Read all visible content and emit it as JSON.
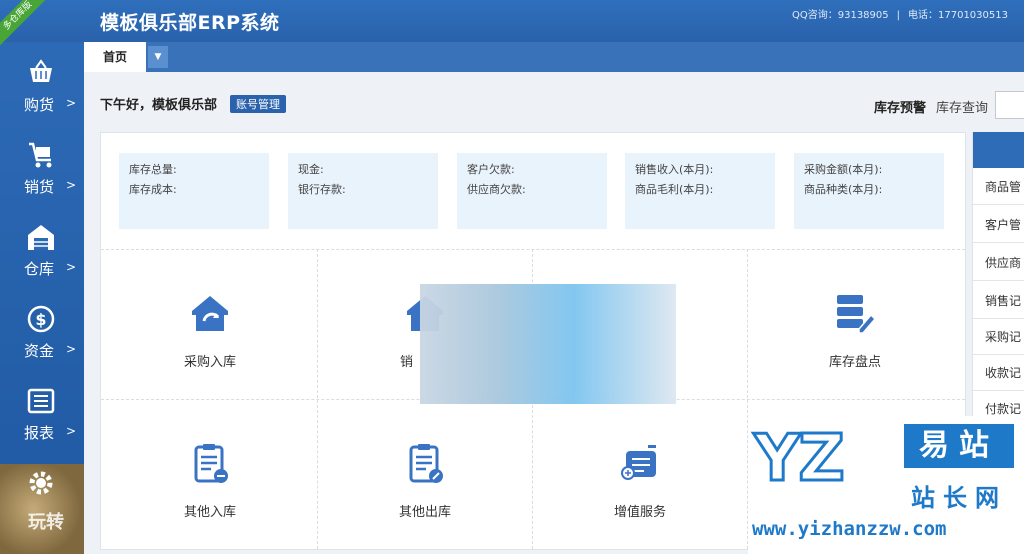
{
  "ribbon": "多仓库版",
  "header": {
    "title": "模板俱乐部ERP系统",
    "qq": "QQ咨询：93138905",
    "phone": "电话：17701030513"
  },
  "sidebar": {
    "items": [
      {
        "label": "购货",
        "icon": "basket-icon"
      },
      {
        "label": "销货",
        "icon": "cart-icon"
      },
      {
        "label": "仓库",
        "icon": "warehouse-icon"
      },
      {
        "label": "资金",
        "icon": "dollar-icon"
      },
      {
        "label": "报表",
        "icon": "report-icon"
      },
      {
        "label": "设置",
        "icon": "gear-icon"
      }
    ]
  },
  "tabs": {
    "home": "首页"
  },
  "greeting": "下午好，模板俱乐部",
  "account_button": "账号管理",
  "stock": {
    "warning": "库存预警",
    "query": "库存查询"
  },
  "stats": [
    {
      "line1": "库存总量:",
      "line2": "库存成本:"
    },
    {
      "line1": "现金:",
      "line2": "银行存款:"
    },
    {
      "line1": "客户欠款:",
      "line2": "供应商欠款:"
    },
    {
      "line1": "销售收入(本月):",
      "line2": "商品毛利(本月):"
    },
    {
      "line1": "采购金额(本月):",
      "line2": "商品种类(本月):"
    }
  ],
  "tiles": [
    {
      "label": "采购入库",
      "icon": "purchase-in-icon"
    },
    {
      "label": "销",
      "icon": "sales-out-icon"
    },
    {
      "label": "",
      "icon": "blurred"
    },
    {
      "label": "库存盘点",
      "icon": "inventory-check-icon"
    },
    {
      "label": "其他入库",
      "icon": "other-in-icon"
    },
    {
      "label": "其他出库",
      "icon": "other-out-icon"
    },
    {
      "label": "增值服务",
      "icon": "value-added-icon"
    }
  ],
  "right_list": [
    "商品管",
    "客户管",
    "供应商",
    "销售记",
    "采购记",
    "收款记",
    "付款记"
  ],
  "watermark": {
    "logo": "YZ",
    "cn1": "易站",
    "cn2": "站长网",
    "url": "www.yizhanzzw.com"
  },
  "corner_watermark": "玩转",
  "colors": {
    "primary": "#2a62ab",
    "accent_icon": "#3b73c4",
    "card_bg": "#e9f3fc"
  }
}
